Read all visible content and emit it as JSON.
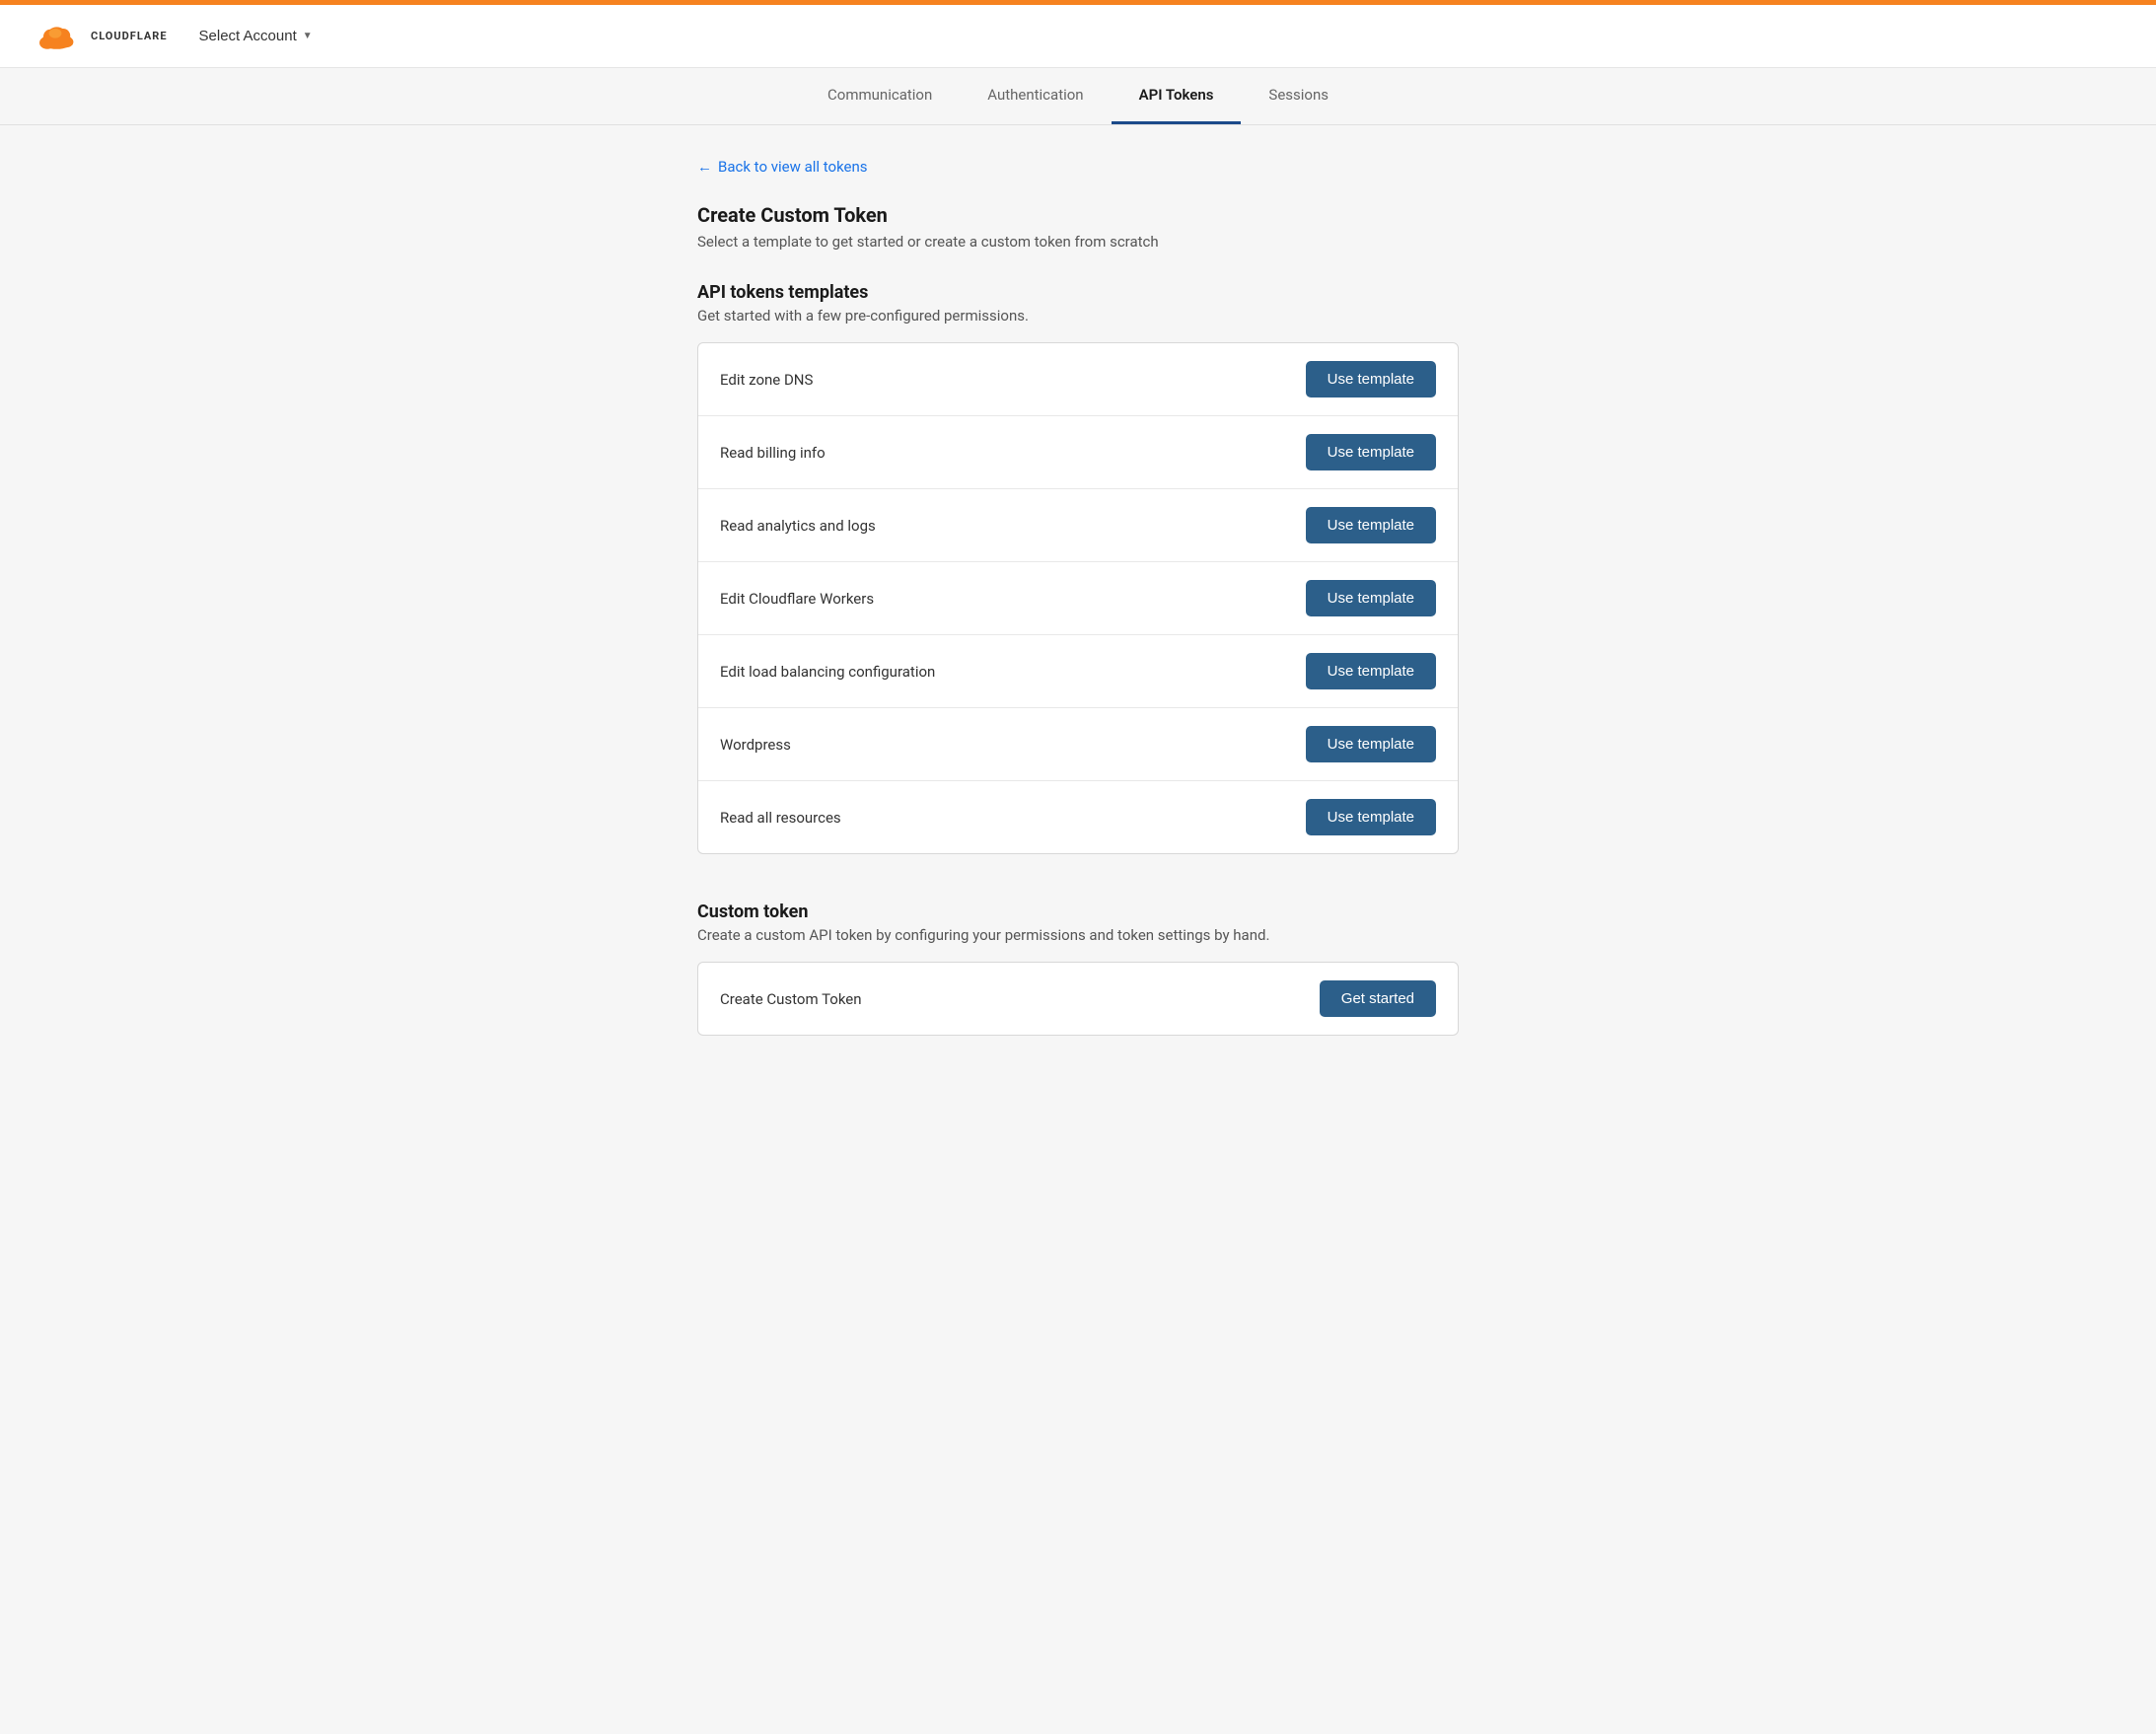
{
  "topBar": {},
  "header": {
    "logoText": "CLOUDFLARE",
    "selectAccount": "Select Account"
  },
  "tabs": {
    "items": [
      {
        "label": "Communication",
        "active": false
      },
      {
        "label": "Authentication",
        "active": false
      },
      {
        "label": "API Tokens",
        "active": true
      },
      {
        "label": "Sessions",
        "active": false
      }
    ]
  },
  "backLink": {
    "arrow": "←",
    "text": "Back to view all tokens"
  },
  "createCustomToken": {
    "title": "Create Custom Token",
    "subtitle": "Select a template to get started or create a custom token from scratch"
  },
  "templatesSection": {
    "title": "API tokens templates",
    "subtitle": "Get started with a few pre-configured permissions.",
    "templates": [
      {
        "name": "Edit zone DNS"
      },
      {
        "name": "Read billing info"
      },
      {
        "name": "Read analytics and logs"
      },
      {
        "name": "Edit Cloudflare Workers"
      },
      {
        "name": "Edit load balancing configuration"
      },
      {
        "name": "Wordpress"
      },
      {
        "name": "Read all resources"
      }
    ],
    "buttonLabel": "Use template"
  },
  "customTokenSection": {
    "title": "Custom token",
    "subtitle": "Create a custom API token by configuring your permissions and token settings by hand.",
    "rowLabel": "Create Custom Token",
    "buttonLabel": "Get started"
  }
}
